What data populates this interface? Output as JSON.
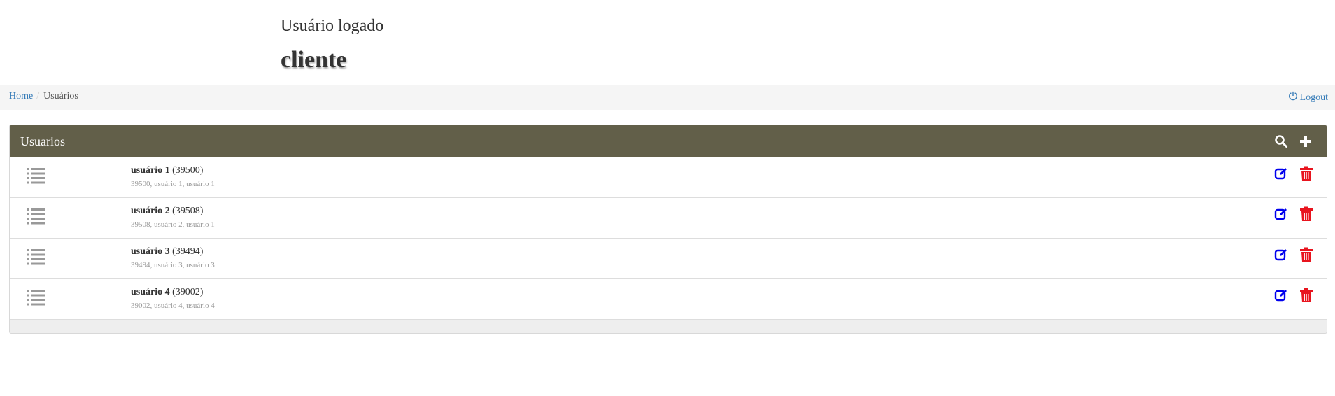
{
  "user": {
    "label": "Usuário logado",
    "name": "cliente"
  },
  "breadcrumb": {
    "home": "Home",
    "current": "Usuários"
  },
  "logout_label": "Logout",
  "panel": {
    "title": "Usuarios"
  },
  "users": [
    {
      "name": "usuário 1",
      "code": "(39500)",
      "details": "39500, usuário 1, usuário 1"
    },
    {
      "name": "usuário 2",
      "code": "(39508)",
      "details": "39508, usuário 2, usuário 1"
    },
    {
      "name": "usuário 3",
      "code": "(39494)",
      "details": "39494, usuário 3, usuário 3"
    },
    {
      "name": "usuário 4",
      "code": "(39002)",
      "details": "39002, usuário 4, usuário 4"
    }
  ],
  "colors": {
    "panel_header": "#625f49",
    "edit_icon": "#0000ee",
    "delete_icon": "#e8141e",
    "link": "#337ab7"
  },
  "icons": {
    "row": "list-icon",
    "edit": "edit-icon",
    "delete": "trash-icon",
    "search": "search-icon",
    "add": "plus-icon",
    "logout": "power-icon"
  }
}
